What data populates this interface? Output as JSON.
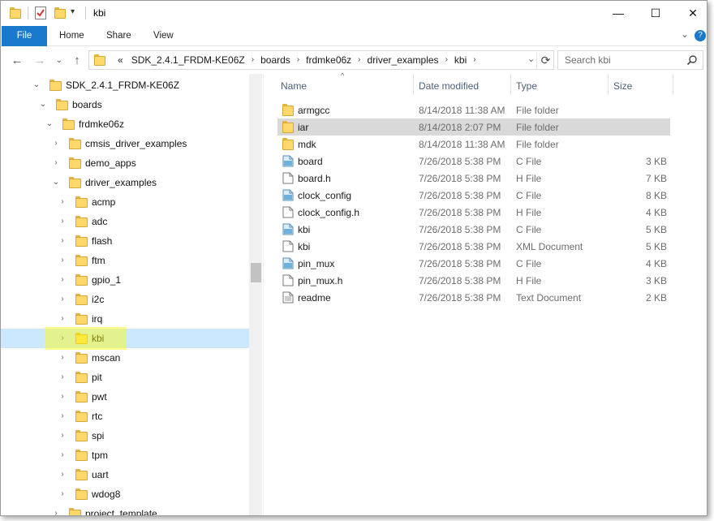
{
  "window": {
    "title": "kbi",
    "controls": {
      "minimize": "—",
      "maximize": "☐",
      "close": "✕"
    }
  },
  "ribbon": {
    "tabs": [
      "File",
      "Home",
      "Share",
      "View"
    ],
    "expand_icon": "⌄",
    "help_icon": "?"
  },
  "nav": {
    "back_icon": "←",
    "forward_icon": "→",
    "recent_icon": "⌄",
    "up_icon": "↑"
  },
  "address": {
    "overflow": "«",
    "crumbs": [
      "SDK_2.4.1_FRDM-KE06Z",
      "boards",
      "frdmke06z",
      "driver_examples",
      "kbi"
    ],
    "dropdown_icon": "⌄",
    "refresh_icon": "⟳"
  },
  "search": {
    "placeholder": "Search kbi"
  },
  "tree": {
    "items": [
      {
        "label": "SDK_2.4.1_FRDM-KE06Z",
        "chev": "⌄"
      },
      {
        "label": "boards",
        "chev": "⌄"
      },
      {
        "label": "frdmke06z",
        "chev": "⌄"
      },
      {
        "label": "cmsis_driver_examples",
        "chev": "›"
      },
      {
        "label": "demo_apps",
        "chev": "›"
      },
      {
        "label": "driver_examples",
        "chev": "⌄"
      },
      {
        "label": "acmp",
        "chev": "›"
      },
      {
        "label": "adc",
        "chev": "›"
      },
      {
        "label": "flash",
        "chev": "›"
      },
      {
        "label": "ftm",
        "chev": "›"
      },
      {
        "label": "gpio_1",
        "chev": "›"
      },
      {
        "label": "i2c",
        "chev": "›"
      },
      {
        "label": "irq",
        "chev": "›"
      },
      {
        "label": "kbi",
        "chev": "›"
      },
      {
        "label": "mscan",
        "chev": "›"
      },
      {
        "label": "pit",
        "chev": "›"
      },
      {
        "label": "pwt",
        "chev": "›"
      },
      {
        "label": "rtc",
        "chev": "›"
      },
      {
        "label": "spi",
        "chev": "›"
      },
      {
        "label": "tpm",
        "chev": "›"
      },
      {
        "label": "uart",
        "chev": "›"
      },
      {
        "label": "wdog8",
        "chev": "›"
      },
      {
        "label": "project_template",
        "chev": "›"
      }
    ]
  },
  "list": {
    "columns": {
      "name": "Name",
      "date": "Date modified",
      "type": "Type",
      "size": "Size"
    },
    "sort_icon": "^",
    "files": [
      {
        "name": "armgcc",
        "date": "8/14/2018 11:38 AM",
        "type": "File folder",
        "size": "",
        "icon": "folder-icon"
      },
      {
        "name": "iar",
        "date": "8/14/2018 2:07 PM",
        "type": "File folder",
        "size": "",
        "icon": "folder-icon"
      },
      {
        "name": "mdk",
        "date": "8/14/2018 11:38 AM",
        "type": "File folder",
        "size": "",
        "icon": "folder-icon"
      },
      {
        "name": "board",
        "date": "7/26/2018 5:38 PM",
        "type": "C File",
        "size": "3 KB",
        "icon": "c-file-icon"
      },
      {
        "name": "board.h",
        "date": "7/26/2018 5:38 PM",
        "type": "H File",
        "size": "7 KB",
        "icon": "h-file-icon"
      },
      {
        "name": "clock_config",
        "date": "7/26/2018 5:38 PM",
        "type": "C File",
        "size": "8 KB",
        "icon": "c-file-icon"
      },
      {
        "name": "clock_config.h",
        "date": "7/26/2018 5:38 PM",
        "type": "H File",
        "size": "4 KB",
        "icon": "h-file-icon"
      },
      {
        "name": "kbi",
        "date": "7/26/2018 5:38 PM",
        "type": "C File",
        "size": "5 KB",
        "icon": "c-file-icon"
      },
      {
        "name": "kbi",
        "date": "7/26/2018 5:38 PM",
        "type": "XML Document",
        "size": "5 KB",
        "icon": "xml-file-icon"
      },
      {
        "name": "pin_mux",
        "date": "7/26/2018 5:38 PM",
        "type": "C File",
        "size": "4 KB",
        "icon": "c-file-icon"
      },
      {
        "name": "pin_mux.h",
        "date": "7/26/2018 5:38 PM",
        "type": "H File",
        "size": "3 KB",
        "icon": "h-file-icon"
      },
      {
        "name": "readme",
        "date": "7/26/2018 5:38 PM",
        "type": "Text Document",
        "size": "2 KB",
        "icon": "text-file-icon"
      }
    ]
  },
  "colors": {
    "accent": "#1979ca",
    "tree_selected": "#cce8ff",
    "row_selected": "#d9d9d9",
    "folder": "#ffd86b",
    "highlight": "#ffff00"
  }
}
